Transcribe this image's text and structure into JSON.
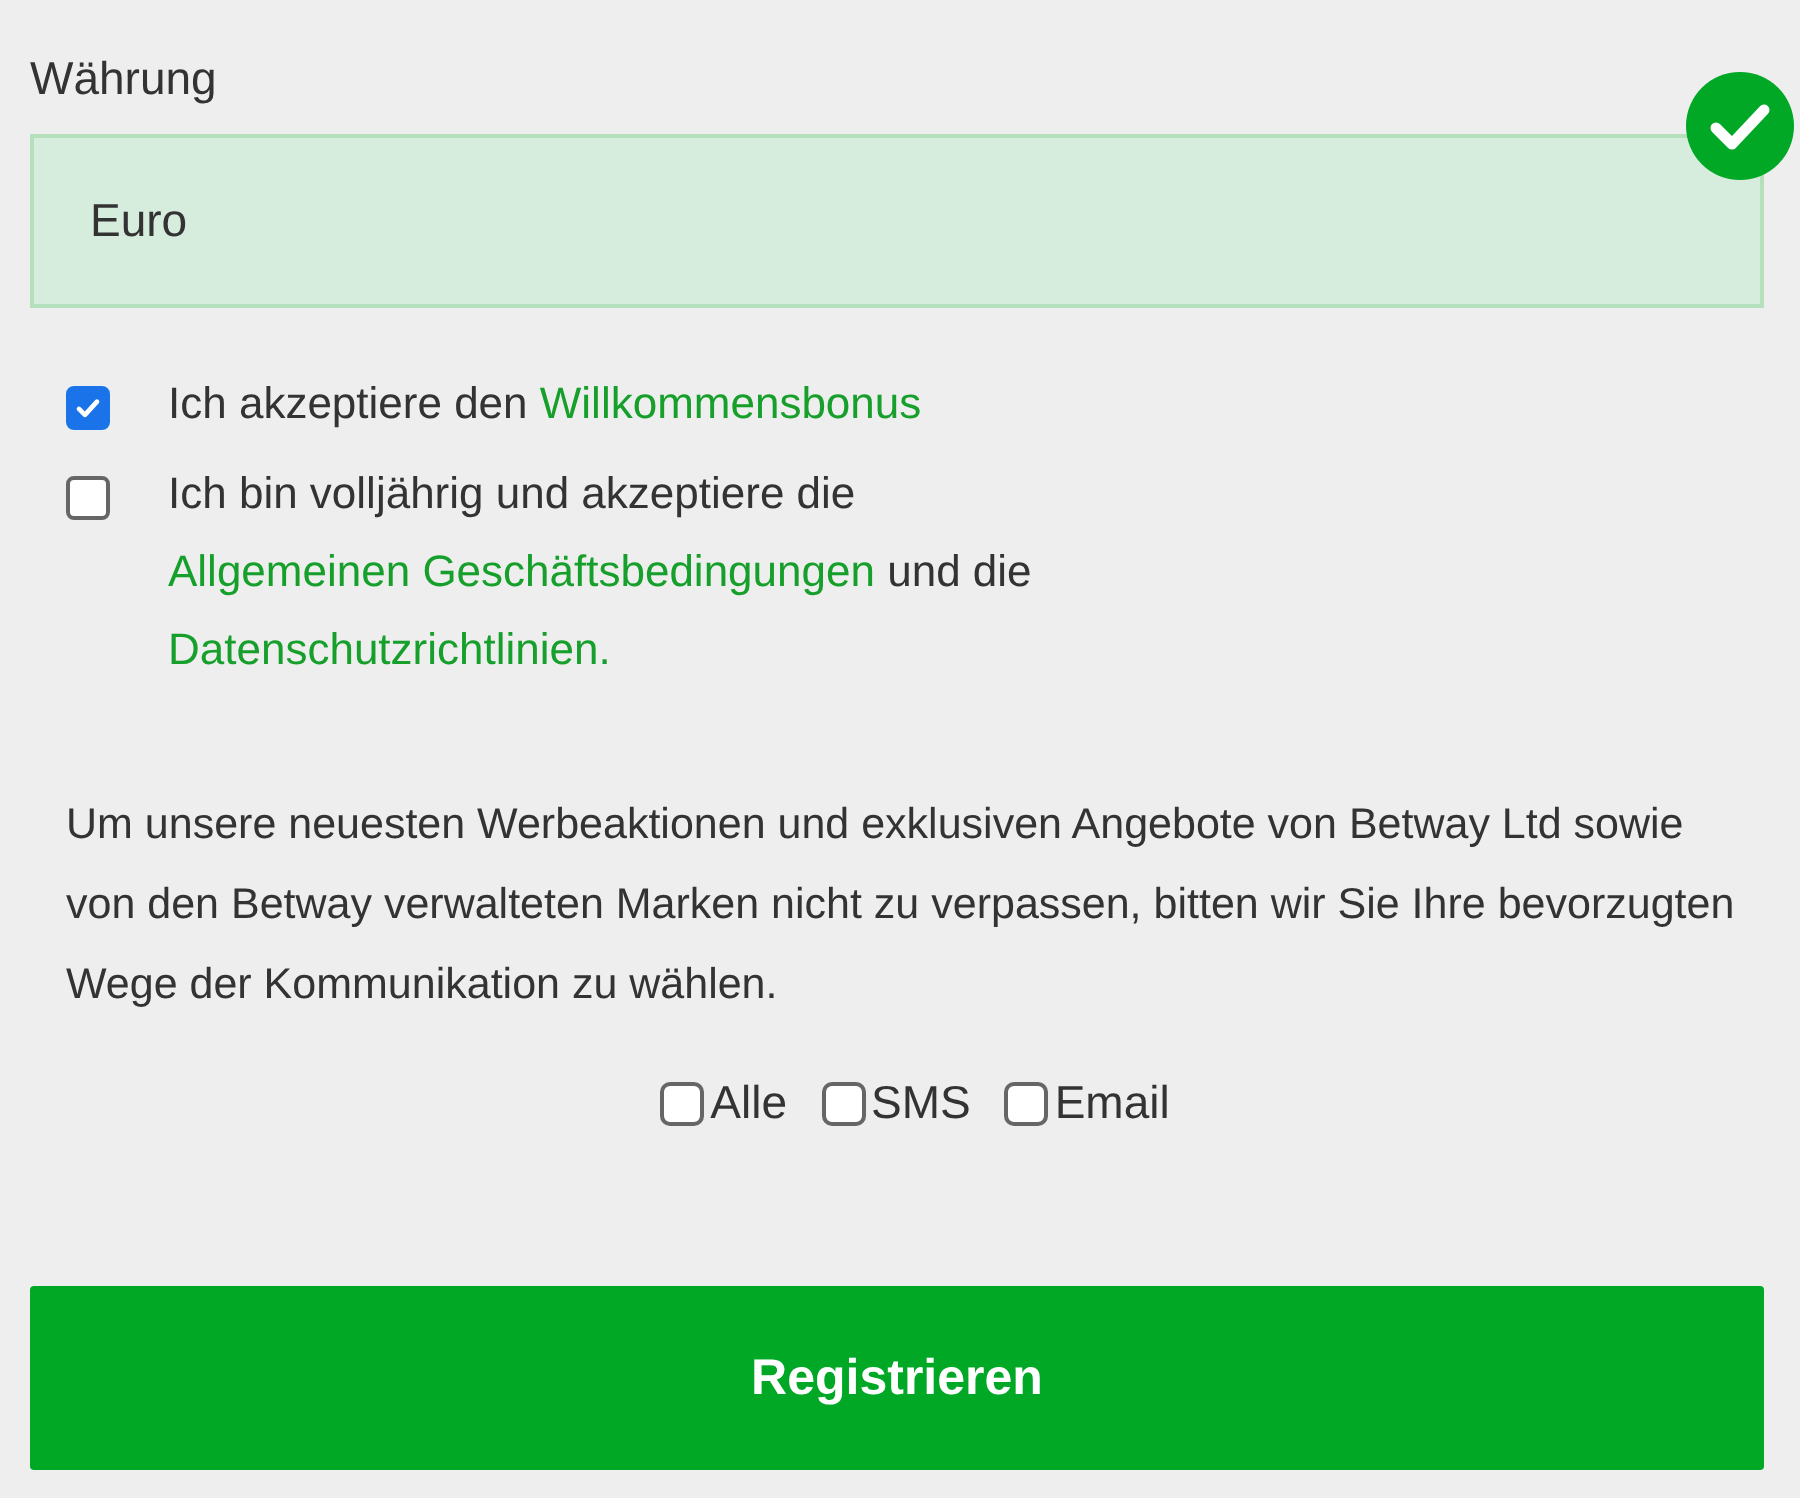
{
  "currency_field": {
    "label": "Währung",
    "value": "Euro",
    "valid": true
  },
  "consents": [
    {
      "checked": true,
      "parts": [
        {
          "kind": "text",
          "text": "Ich akzeptiere den"
        },
        {
          "kind": "link",
          "text": "Willkommensbonus"
        }
      ]
    },
    {
      "checked": false,
      "parts": [
        {
          "kind": "text",
          "text": "Ich bin volljährig und akzeptiere die"
        },
        {
          "kind": "link",
          "text": "Allgemeinen Geschäftsbedingungen"
        },
        {
          "kind": "text",
          "text": "und die"
        },
        {
          "kind": "link",
          "text": "Datenschutzrichtlinien."
        }
      ]
    }
  ],
  "marketing_text": "Um unsere neuesten Werbeaktionen und exklusiven Angebote von Betway Ltd sowie von den Betway verwalteten Marken nicht zu verpassen, bitten wir Sie Ihre bevorzugten Wege der Kommunikation zu wählen.",
  "channels": [
    {
      "label": "Alle",
      "checked": false
    },
    {
      "label": "SMS",
      "checked": false
    },
    {
      "label": "Email",
      "checked": false
    }
  ],
  "submit_button": "Registrieren"
}
